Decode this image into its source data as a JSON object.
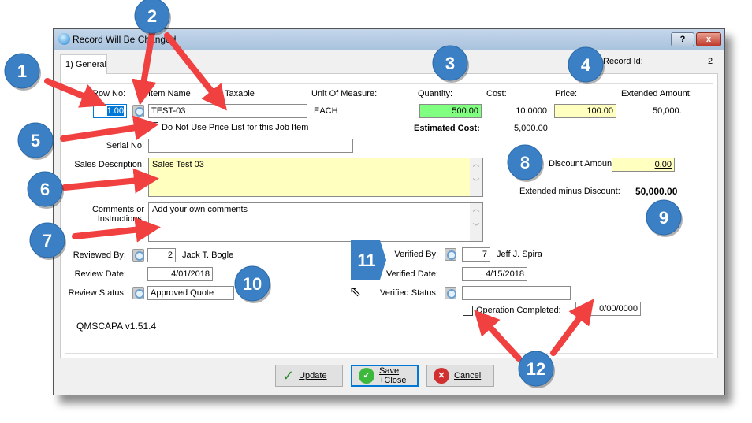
{
  "window": {
    "title": "Record Will Be Changed",
    "help_label": "?",
    "close_label": "x"
  },
  "tabs": [
    {
      "label": "1) General"
    }
  ],
  "record_id": {
    "label": "Record Id:",
    "value": "2"
  },
  "headers": {
    "row_no": "Row No:",
    "item_name": "Item Name",
    "taxable": "Taxable",
    "uom": "Unit Of Measure:",
    "quantity": "Quantity:",
    "cost": "Cost:",
    "price": "Price:",
    "extended": "Extended Amount:"
  },
  "row": {
    "row_no": "1.00",
    "item_name": "TEST-03",
    "taxable": true,
    "uom": "EACH",
    "quantity": "500.00",
    "cost": "10.0000",
    "price": "100.00",
    "extended": "50,000."
  },
  "no_price_list": {
    "label": "Do Not Use Price List for this Job Item",
    "checked": false
  },
  "estimated_cost": {
    "label": "Estimated Cost:",
    "value": "5,000.00"
  },
  "serial_no": {
    "label": "Serial No:",
    "value": ""
  },
  "sales_description": {
    "label": "Sales Description:",
    "value": "Sales Test 03"
  },
  "comments": {
    "label1": "Comments or",
    "label2": "Instructions:",
    "value": "Add your own comments"
  },
  "discount": {
    "label": "Discount Amount:",
    "value": "0.00"
  },
  "ext_minus_discount": {
    "label": "Extended minus Discount:",
    "value": "50,000.00"
  },
  "review": {
    "by_label": "Reviewed By:",
    "by_id": "2",
    "by_name": "Jack T. Bogle",
    "date_label": "Review Date:",
    "date": "4/01/2018",
    "status_label": "Review Status:",
    "status": "Approved Quote"
  },
  "verify": {
    "by_label": "Verified By:",
    "by_id": "7",
    "by_name": "Jeff J. Spira",
    "date_label": "Verified Date:",
    "date": "4/15/2018",
    "status_label": "Verified Status:",
    "status": ""
  },
  "operation": {
    "label": "Operation Completed:",
    "checked": false,
    "date": "0/00/0000"
  },
  "version": "QMSCAPA v1.51.4",
  "buttons": {
    "update": "Update",
    "save_close_1": "Save",
    "save_close_2": "+Close",
    "cancel": "Cancel"
  },
  "annotations": [
    "1",
    "2",
    "3",
    "4",
    "5",
    "6",
    "7",
    "8",
    "9",
    "10",
    "11",
    "12"
  ],
  "colors": {
    "quantity_bg": "#80ff80",
    "yellow_bg": "#ffffc0",
    "annotation_blue": "#3b7fc4",
    "arrow_red": "#f04040"
  }
}
